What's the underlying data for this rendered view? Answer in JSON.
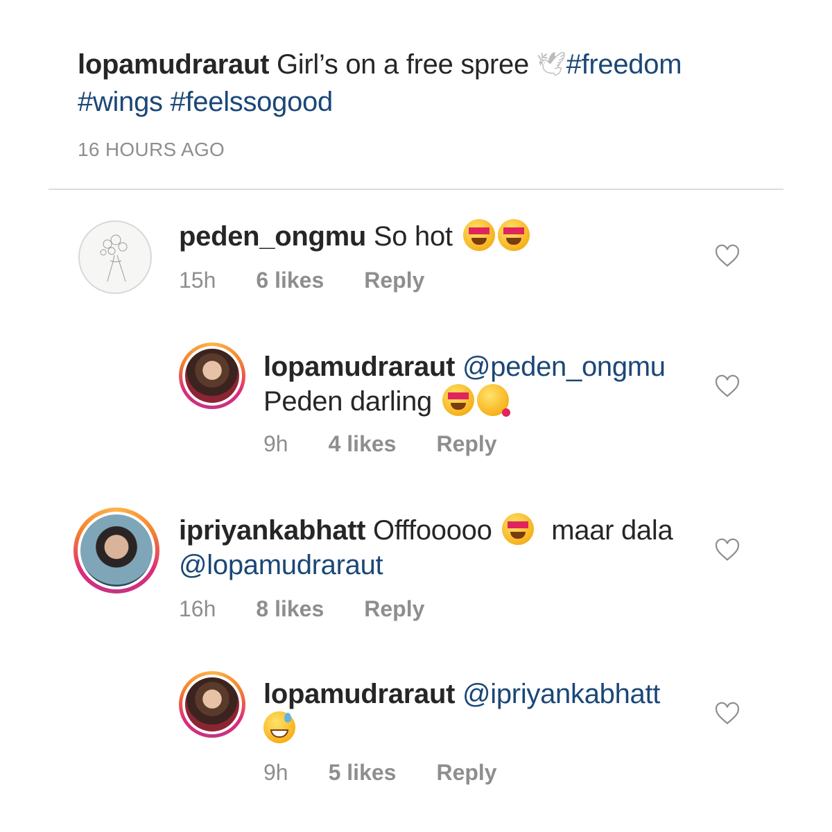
{
  "caption": {
    "username": "lopamudraraut",
    "text": "Girl’s on a free spree",
    "dove_icon": "dove-emoji",
    "hashtags": [
      "#freedom",
      "#wings",
      "#feelssogood"
    ],
    "time_ago": "16 HOURS AGO"
  },
  "comments": [
    {
      "username": "peden_ongmu",
      "text": "So hot",
      "emojis": [
        "heart-eyes",
        "heart-eyes"
      ],
      "time": "15h",
      "likes": "6 likes",
      "reply": "Reply"
    },
    {
      "username": "lopamudraraut",
      "mention": "@peden_ongmu",
      "text": "Peden darling",
      "emojis": [
        "heart-eyes",
        "kissing-heart"
      ],
      "time": "9h",
      "likes": "4 likes",
      "reply": "Reply"
    },
    {
      "username": "ipriyankabhatt",
      "text": "Offfooooo",
      "text_after": "maar dala",
      "mention": "@lopamudraraut",
      "emojis": [
        "heart-eyes"
      ],
      "time": "16h",
      "likes": "8 likes",
      "reply": "Reply"
    },
    {
      "username": "lopamudraraut",
      "mention": "@ipriyankabhatt",
      "emojis": [
        "grinning-sweat"
      ],
      "time": "9h",
      "likes": "5 likes",
      "reply": "Reply"
    }
  ],
  "colors": {
    "link": "#1b4777",
    "muted": "#8e8e8e",
    "text": "#262626"
  }
}
